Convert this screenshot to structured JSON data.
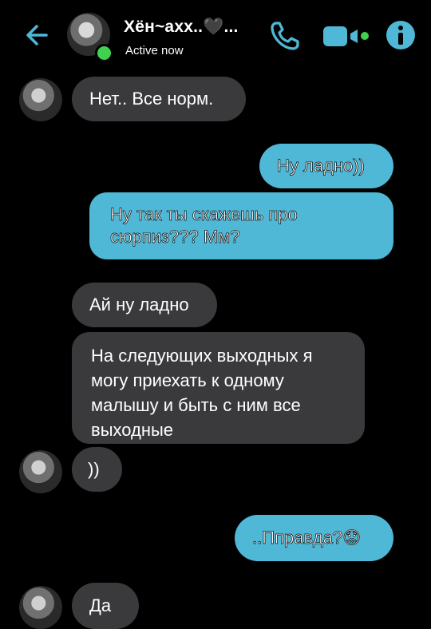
{
  "header": {
    "contact_name": "Хён~ахх..🖤...",
    "status": "Active now",
    "colors": {
      "accent": "#4fb8d6",
      "online": "#3fd24f"
    }
  },
  "icons": {
    "back": "back-arrow-icon",
    "phone": "phone-icon",
    "video": "video-camera-icon",
    "info": "info-icon"
  },
  "messages": [
    {
      "side": "in",
      "text": "Нет.. Все норм."
    },
    {
      "side": "out",
      "text": "Ну ладно))"
    },
    {
      "side": "out",
      "text": "Ну так ты скажешь про сюрпиз??? Мм?"
    },
    {
      "side": "in",
      "text": "Ай ну ладно"
    },
    {
      "side": "in",
      "text": "На следующих выходных я могу приехать к одному малышу и быть с ним все выходные"
    },
    {
      "side": "in",
      "text": "))"
    },
    {
      "side": "out",
      "text": "..Пправда?😟"
    },
    {
      "side": "in",
      "text": "Да"
    }
  ]
}
